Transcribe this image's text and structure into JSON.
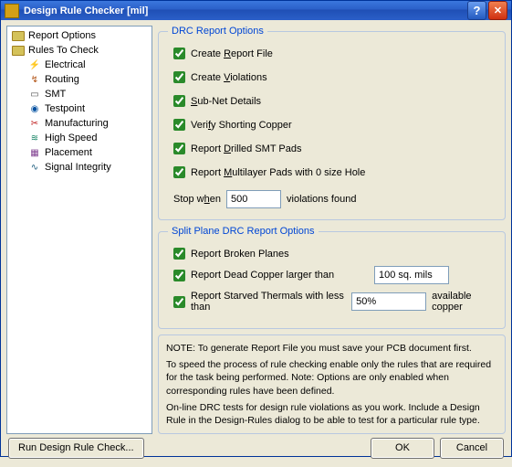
{
  "window": {
    "title": "Design Rule Checker [mil]"
  },
  "tree": {
    "root1": "Report Options",
    "root2": "Rules To Check",
    "children": [
      "Electrical",
      "Routing",
      "SMT",
      "Testpoint",
      "Manufacturing",
      "High Speed",
      "Placement",
      "Signal Integrity"
    ]
  },
  "group1": {
    "legend": "DRC Report Options",
    "opts": [
      {
        "pre": "Create ",
        "u": "R",
        "post": "eport File",
        "checked": true
      },
      {
        "pre": "Create ",
        "u": "V",
        "post": "iolations",
        "checked": true
      },
      {
        "pre": "",
        "u": "S",
        "post": "ub-Net Details",
        "checked": true
      },
      {
        "pre": "Veri",
        "u": "f",
        "post": "y Shorting Copper",
        "checked": true
      },
      {
        "pre": "Report ",
        "u": "D",
        "post": "rilled SMT Pads",
        "checked": true
      },
      {
        "pre": "Report ",
        "u": "M",
        "post": "ultilayer Pads with 0 size Hole",
        "checked": true
      }
    ],
    "stop_pre": "Stop w",
    "stop_u": "h",
    "stop_post": "en",
    "stop_val": "500",
    "stop_suffix": "violations found"
  },
  "group2": {
    "legend": "Split Plane DRC Report Options",
    "o1": {
      "label": "Report Broken Planes",
      "checked": true
    },
    "o2": {
      "label": "Report Dead Copper larger than",
      "checked": true,
      "val": "100 sq. mils"
    },
    "o3": {
      "label": "Report Starved Thermals with less than",
      "checked": true,
      "val": "50%",
      "suffix": "available copper"
    }
  },
  "note": {
    "p1": "NOTE: To generate Report File you must save your PCB document first.",
    "p2": "To speed the process of rule checking enable only the rules that are required for the task being performed.  Note: Options are only enabled when corresponding rules have been defined.",
    "p3": "On-line DRC tests for design rule violations as you work. Include a Design Rule in the Design-Rules dialog to be able to test for a particular rule  type."
  },
  "buttons": {
    "run": "Run Design Rule Check...",
    "ok": "OK",
    "cancel": "Cancel"
  }
}
